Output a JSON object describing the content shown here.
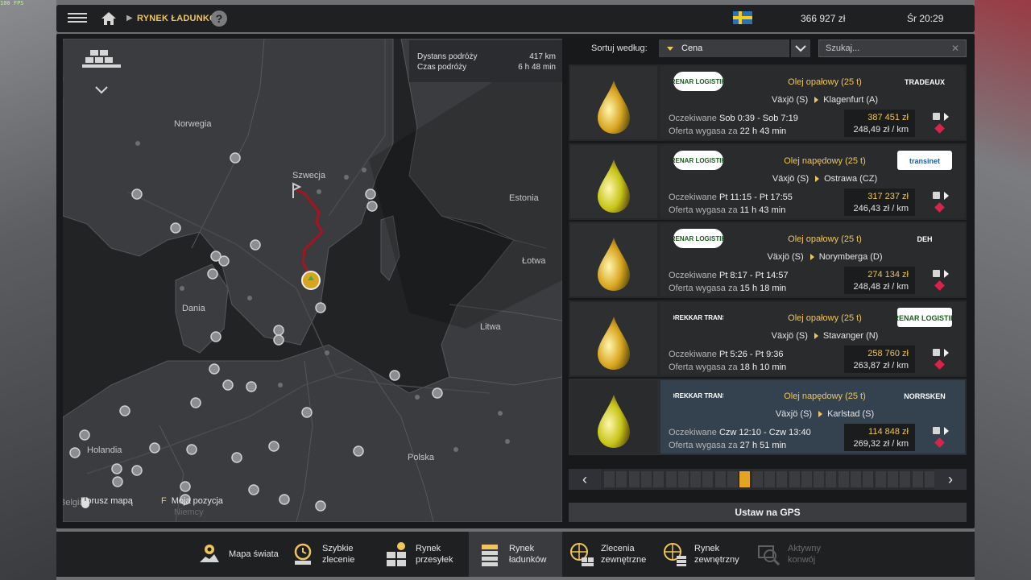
{
  "overlay": {
    "fps": "100 FPS"
  },
  "topbar": {
    "breadcrumb": "RYNEK ŁADUNKÓW",
    "help": "?",
    "money": "366 927 zł",
    "clock": "Śr 20:29"
  },
  "route_info": {
    "distance_label": "Dystans podróży",
    "distance_value": "417 km",
    "time_label": "Czas podróży",
    "time_value": "6 h 48 min"
  },
  "map": {
    "labels": {
      "norway": "Norwegia",
      "sweden": "Szwecja",
      "estonia": "Estonia",
      "latvia": "Łotwa",
      "lithuania": "Litwa",
      "denmark": "Dania",
      "netherlands": "Holandia",
      "poland": "Polska",
      "germany": "Niemcy",
      "belgium": "Belgia"
    },
    "hints": {
      "move_key": "",
      "move_label": "Porusz mapą",
      "position_key": "F",
      "position_label": "Moja pozycja"
    }
  },
  "sort": {
    "label": "Sortuj według:",
    "selected": "Cena",
    "search_placeholder": "Szukaj...",
    "clear": "✕"
  },
  "jobs": [
    {
      "cargo": "Olej opałowy (25 t)",
      "from": "Växjö (S)",
      "to": "Klagenfurt (A)",
      "expected_label": "Oczekiwane",
      "expected": "Sob 0:39 - Sob 7:19",
      "valid_label": "Oferta wygasa za",
      "valid": "22 h 43 min",
      "price": "387 451 zł",
      "per_km": "248,49 zł / km",
      "logo_left": "RENAR LOGISTIK",
      "logo_right": "TRADEAUX",
      "drop_color": "#d9a520"
    },
    {
      "cargo": "Olej napędowy (25 t)",
      "from": "Växjö (S)",
      "to": "Ostrawa (CZ)",
      "expected_label": "Oczekiwane",
      "expected": "Pt 11:15 - Pt 17:55",
      "valid_label": "Oferta wygasa za",
      "valid": "11 h 43 min",
      "price": "317 237 zł",
      "per_km": "246,43 zł / km",
      "logo_left": "RENAR LOGISTIK",
      "logo_right": "transinet",
      "drop_color": "#c7c417"
    },
    {
      "cargo": "Olej opałowy (25 t)",
      "from": "Växjö (S)",
      "to": "Norymberga (D)",
      "expected_label": "Oczekiwane",
      "expected": "Pt 8:17 - Pt 14:57",
      "valid_label": "Oferta wygasa za",
      "valid": "15 h 18 min",
      "price": "274 134 zł",
      "per_km": "248,48 zł / km",
      "logo_left": "RENAR LOGISTIK",
      "logo_right": "DEH",
      "drop_color": "#d9a520"
    },
    {
      "cargo": "Olej opałowy (25 t)",
      "from": "Växjö (S)",
      "to": "Stavanger (N)",
      "expected_label": "Oczekiwane",
      "expected": "Pt 5:26 - Pt 9:36",
      "valid_label": "Oferta wygasa za",
      "valid": "18 h 10 min",
      "price": "258 760 zł",
      "per_km": "263,87 zł / km",
      "logo_left": "DREKKAR TRANS",
      "logo_right": "RENAR LOGISTIK",
      "drop_color": "#d9a520"
    },
    {
      "cargo": "Olej napędowy (25 t)",
      "from": "Växjö (S)",
      "to": "Karlstad (S)",
      "expected_label": "Oczekiwane",
      "expected": "Czw 12:10 - Czw 13:40",
      "valid_label": "Oferta wygasa za",
      "valid": "27 h 51 min",
      "price": "114 848 zł",
      "per_km": "269,32 zł / km",
      "logo_left": "DREKKAR TRANS",
      "logo_right": "NORRSKEN",
      "drop_color": "#c7c417"
    }
  ],
  "pager": {
    "current_page": 11,
    "total_pages": 29,
    "prev": "‹",
    "next": "›"
  },
  "gps_button": "Ustaw na GPS",
  "bottom_tabs": [
    {
      "label_1": "Mapa świata",
      "label_2": "",
      "icon": "globe-marker-icon"
    },
    {
      "label_1": "Szybkie",
      "label_2": "zlecenie",
      "icon": "stopwatch-icon"
    },
    {
      "label_1": "Rynek",
      "label_2": "przesyłek",
      "icon": "cargo-boxes-icon"
    },
    {
      "label_1": "Rynek",
      "label_2": "ładunków",
      "icon": "cargo-stack-icon"
    },
    {
      "label_1": "Zlecenia",
      "label_2": "zewnętrzne",
      "icon": "world-boxes-icon"
    },
    {
      "label_1": "Rynek",
      "label_2": "zewnętrzny",
      "icon": "world-market-icon"
    },
    {
      "label_1": "Aktywny",
      "label_2": "konwój",
      "icon": "convoy-icon"
    }
  ],
  "colors": {
    "accent": "#f0c65a",
    "danger": "#d8234b",
    "route": "#a8141e",
    "selected_row": "#34414e"
  }
}
